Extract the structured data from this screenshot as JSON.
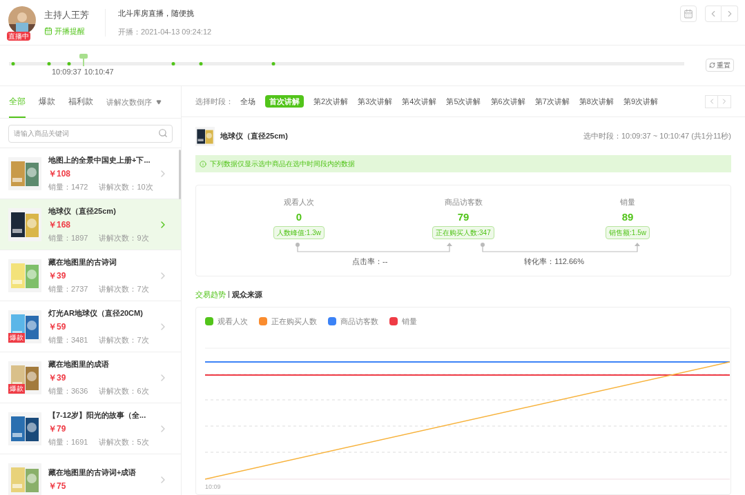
{
  "host": {
    "live_badge": "直播中",
    "name": "主持人王芳",
    "reminder": "开播提醒"
  },
  "stream": {
    "title": "北斗库房直播，随便挑",
    "start": "开播：2021-04-13 09:24:12"
  },
  "timeline": {
    "labels": [
      "10:09:37",
      "10:10:47"
    ],
    "reset": "重置"
  },
  "filter_tabs": [
    {
      "label": "全部",
      "selected": true
    },
    {
      "label": "爆款",
      "selected": false
    },
    {
      "label": "福利款",
      "selected": false
    }
  ],
  "sort": {
    "label": "讲解次数倒序"
  },
  "search": {
    "placeholder": "请输入商品关键词"
  },
  "products": [
    {
      "name": "地图上的全景中国史上册+下...",
      "price": "￥108",
      "sales": "销量：1472",
      "explains": "讲解次数：10次",
      "selected": false
    },
    {
      "name": "地球仪（直径25cm)",
      "price": "￥168",
      "sales": "销量：1897",
      "explains": "讲解次数：9次",
      "selected": true
    },
    {
      "name": "藏在地图里的古诗词",
      "price": "￥39",
      "sales": "销量：2737",
      "explains": "讲解次数：7次",
      "selected": false
    },
    {
      "name": "灯光AR地球仪（直径20CM)",
      "price": "￥59",
      "sales": "销量：3481",
      "explains": "讲解次数：7次",
      "selected": false,
      "badge": "爆款"
    },
    {
      "name": "藏在地图里的成语",
      "price": "￥39",
      "sales": "销量：3636",
      "explains": "讲解次数：6次",
      "selected": false,
      "badge": "爆款"
    },
    {
      "name": "【7-12岁】阳光的故事（全...",
      "price": "￥79",
      "sales": "销量：1691",
      "explains": "讲解次数：5次",
      "selected": false
    },
    {
      "name": "藏在地图里的古诗词+成语",
      "price": "￥75",
      "selected": false
    }
  ],
  "periods": {
    "label": "选择时段：",
    "items": [
      {
        "label": "全场",
        "selected": false
      },
      {
        "label": "首次讲解",
        "selected": true
      },
      {
        "label": "第2次讲解",
        "selected": false
      },
      {
        "label": "第3次讲解",
        "selected": false
      },
      {
        "label": "第4次讲解",
        "selected": false
      },
      {
        "label": "第5次讲解",
        "selected": false
      },
      {
        "label": "第6次讲解",
        "selected": false
      },
      {
        "label": "第7次讲解",
        "selected": false
      },
      {
        "label": "第8次讲解",
        "selected": false
      },
      {
        "label": "第9次讲解",
        "selected": false
      }
    ]
  },
  "detail": {
    "name": "地球仪（直径25cm)",
    "period": "选中时段：10:09:37 ~ 10:10:47 (共1分11秒)",
    "notice": "下列数据仅显示选中商品在选中时间段内的数据"
  },
  "metrics": [
    {
      "label": "观看人次",
      "value": "0",
      "tag": "人数峰值:1.3w"
    },
    {
      "label": "商品访客数",
      "value": "79",
      "tag": "正在购买人数:347"
    },
    {
      "label": "销量",
      "value": "89",
      "tag": "销售额:1.5w"
    }
  ],
  "rates": [
    "点击率：--",
    "转化率：112.66%"
  ],
  "chart_tabs": [
    {
      "label": "交易趋势",
      "selected": true
    },
    {
      "label": "观众来源",
      "selected": false
    }
  ],
  "chart": {
    "legend": [
      {
        "label": "观看人次",
        "color": "#52c41a"
      },
      {
        "label": "正在购买人数",
        "color": "#fa8c2e"
      },
      {
        "label": "商品访客数",
        "color": "#3b82f6"
      },
      {
        "label": "销量",
        "color": "#ef3b45"
      }
    ],
    "x_label": "10:09"
  }
}
